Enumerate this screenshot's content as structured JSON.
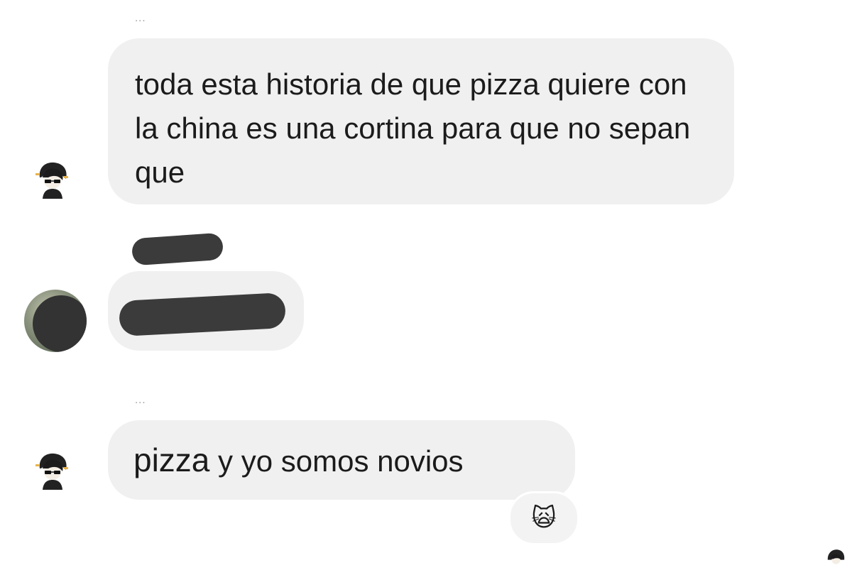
{
  "chat": {
    "messages": [
      {
        "sender_label": "...",
        "name_word": "pizza",
        "text": "toda esta historia de que ",
        "text_after": " quiere con la china es una cortina para que no sepan que"
      },
      {
        "sender_label": "",
        "text": ""
      },
      {
        "sender_label": "...",
        "name_word": "pizza",
        "text_after": " y yo somos novios",
        "reaction": {
          "emoji": "🙀",
          "icon": "screaming-cat-emoji"
        }
      }
    ]
  },
  "colors": {
    "bubble": "#f0f0f0",
    "text": "#1b1b1b",
    "meta": "#9a9a9a",
    "redaction": "#3b3b3b"
  }
}
